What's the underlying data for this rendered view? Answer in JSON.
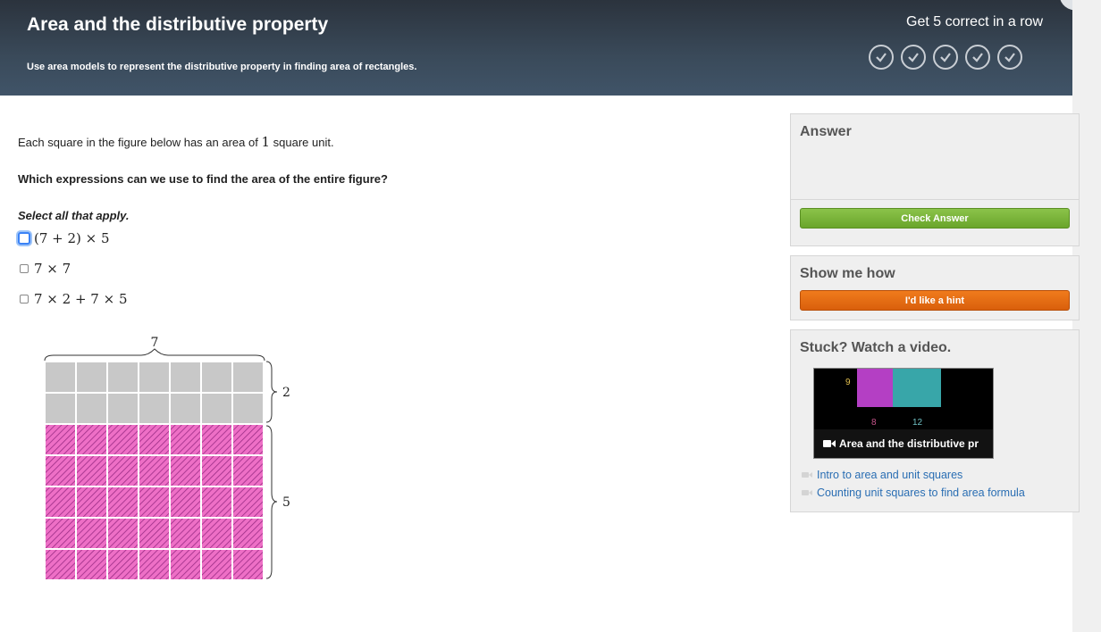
{
  "header": {
    "title": "Area and the distributive property",
    "subtitle": "Use area models to represent the distributive property in finding area of rectangles.",
    "streak_label": "Get 5 correct in a row",
    "streak_checks": 5
  },
  "question": {
    "line1_pre": "Each square in the figure below has an area of ",
    "line1_num": "1",
    "line1_post": " square unit.",
    "line2": "Which expressions can we use to find the area of the entire figure?",
    "instruction": "Select all that apply.",
    "options": [
      "(7 + 2) × 5",
      "7 × 7",
      "7 × 2 + 7 × 5"
    ]
  },
  "figure": {
    "top_label": "7",
    "right_label_top": "2",
    "right_label_bottom": "5",
    "columns": 7,
    "gray_rows": 2,
    "pink_rows": 5,
    "gray_color": "#c8c8c8",
    "pink_color": "#ee6fc6",
    "hatch_color": "#9b2c85"
  },
  "answer_panel": {
    "title": "Answer",
    "check_button": "Check Answer"
  },
  "hint_panel": {
    "title": "Show me how",
    "hint_button": "I'd like a hint"
  },
  "video_panel": {
    "title": "Stuck? Watch a video.",
    "thumbnail_caption": "Area and the distributive pr",
    "thumbnail_numbers": [
      "9",
      "8",
      "12"
    ],
    "links": [
      "Intro to area and unit squares",
      "Counting unit squares to find area formula"
    ]
  },
  "colors": {
    "header_bg": "#343f4b",
    "check_green": "#6aa52b",
    "hint_orange": "#e06a12",
    "link_blue": "#2a6eb3"
  }
}
